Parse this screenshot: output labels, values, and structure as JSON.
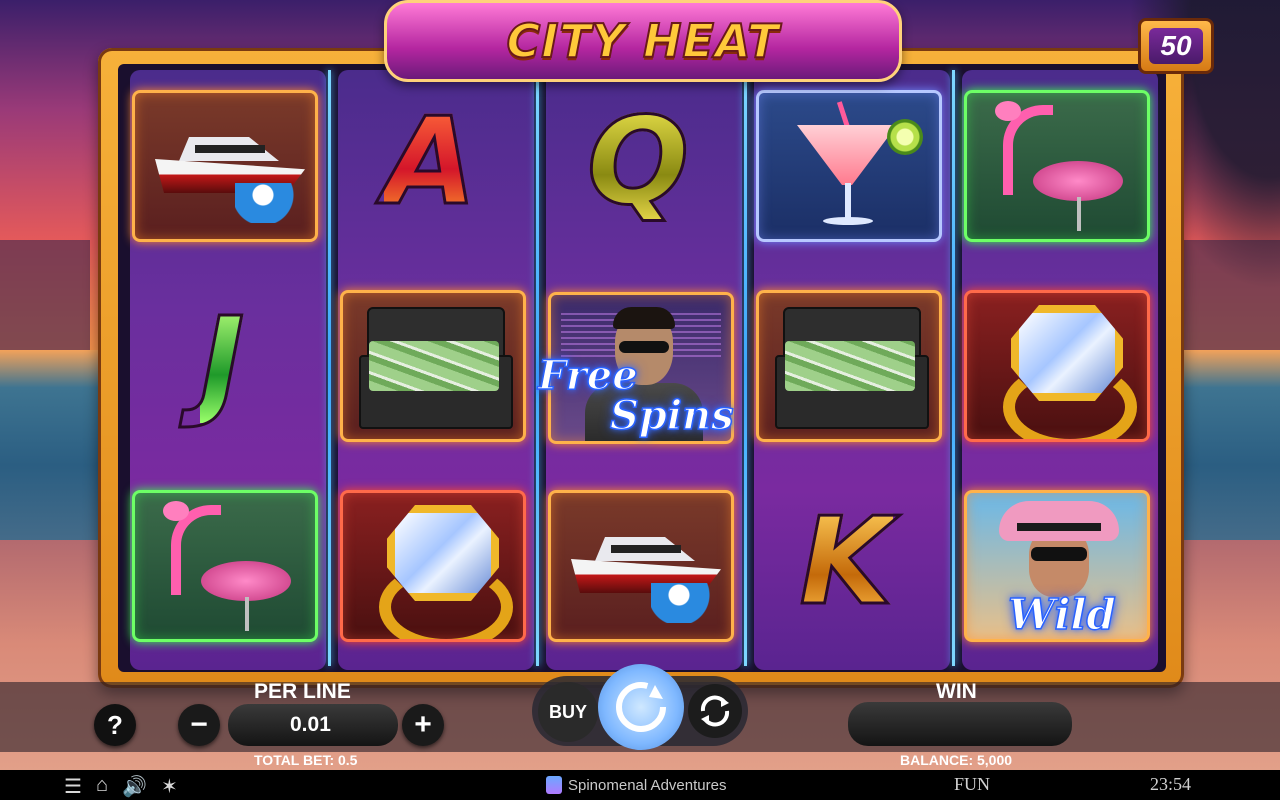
{
  "game": {
    "title": "CITY HEAT",
    "lines_count": "50"
  },
  "reels": [
    [
      "yacht",
      "J",
      "flamingo"
    ],
    [
      "A",
      "briefcase",
      "ring"
    ],
    [
      "Q",
      "free-spins-gangster",
      "yacht"
    ],
    [
      "cocktail",
      "briefcase",
      "K"
    ],
    [
      "flamingo",
      "ring",
      "wild-woman"
    ]
  ],
  "symbols": {
    "letter_a": "A",
    "letter_q": "Q",
    "letter_j": "J",
    "letter_k": "K",
    "free_spins_line1": "Free",
    "free_spins_line2": "Spins",
    "wild": "Wild"
  },
  "controls": {
    "help_label": "?",
    "minus_label": "−",
    "plus_label": "+",
    "per_line_label": "PER LINE",
    "per_line_value": "0.01",
    "buy_label": "BUY",
    "win_label": "WIN",
    "total_bet": "TOTAL BET: 0.5",
    "balance": "BALANCE: 5,000"
  },
  "status_bar": {
    "icons": [
      "menu-icon",
      "home-icon",
      "sound-icon",
      "turbo-icon"
    ],
    "brand": "Spinomenal Adventures",
    "mode": "FUN",
    "time": "23:54"
  },
  "colors": {
    "frame": "#f7b13a",
    "reel": "#6a2f9e",
    "divider": "#3aa7ff",
    "title": "#ffc93a"
  }
}
